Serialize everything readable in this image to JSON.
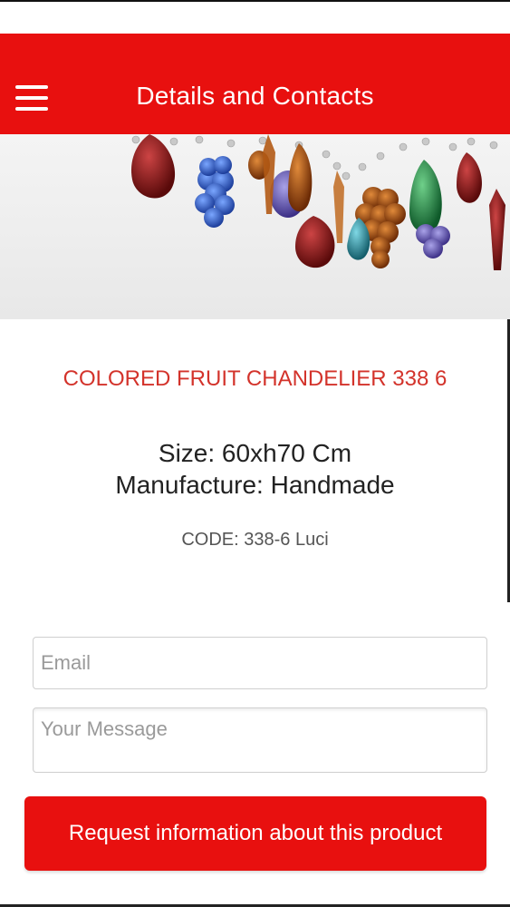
{
  "header": {
    "title": "Details and Contacts",
    "accent_color": "#e8100f",
    "menu_icon": "hamburger-menu-icon"
  },
  "product": {
    "title": "COLORED FRUIT CHANDELIER 338 6",
    "size": "Size: 60xh70 Cm",
    "manufacture": "Manufacture: Handmade",
    "code": "CODE: 338-6 Luci"
  },
  "form": {
    "email_placeholder": "Email",
    "message_placeholder": "Your Message",
    "submit_label": "Request information about this product"
  }
}
